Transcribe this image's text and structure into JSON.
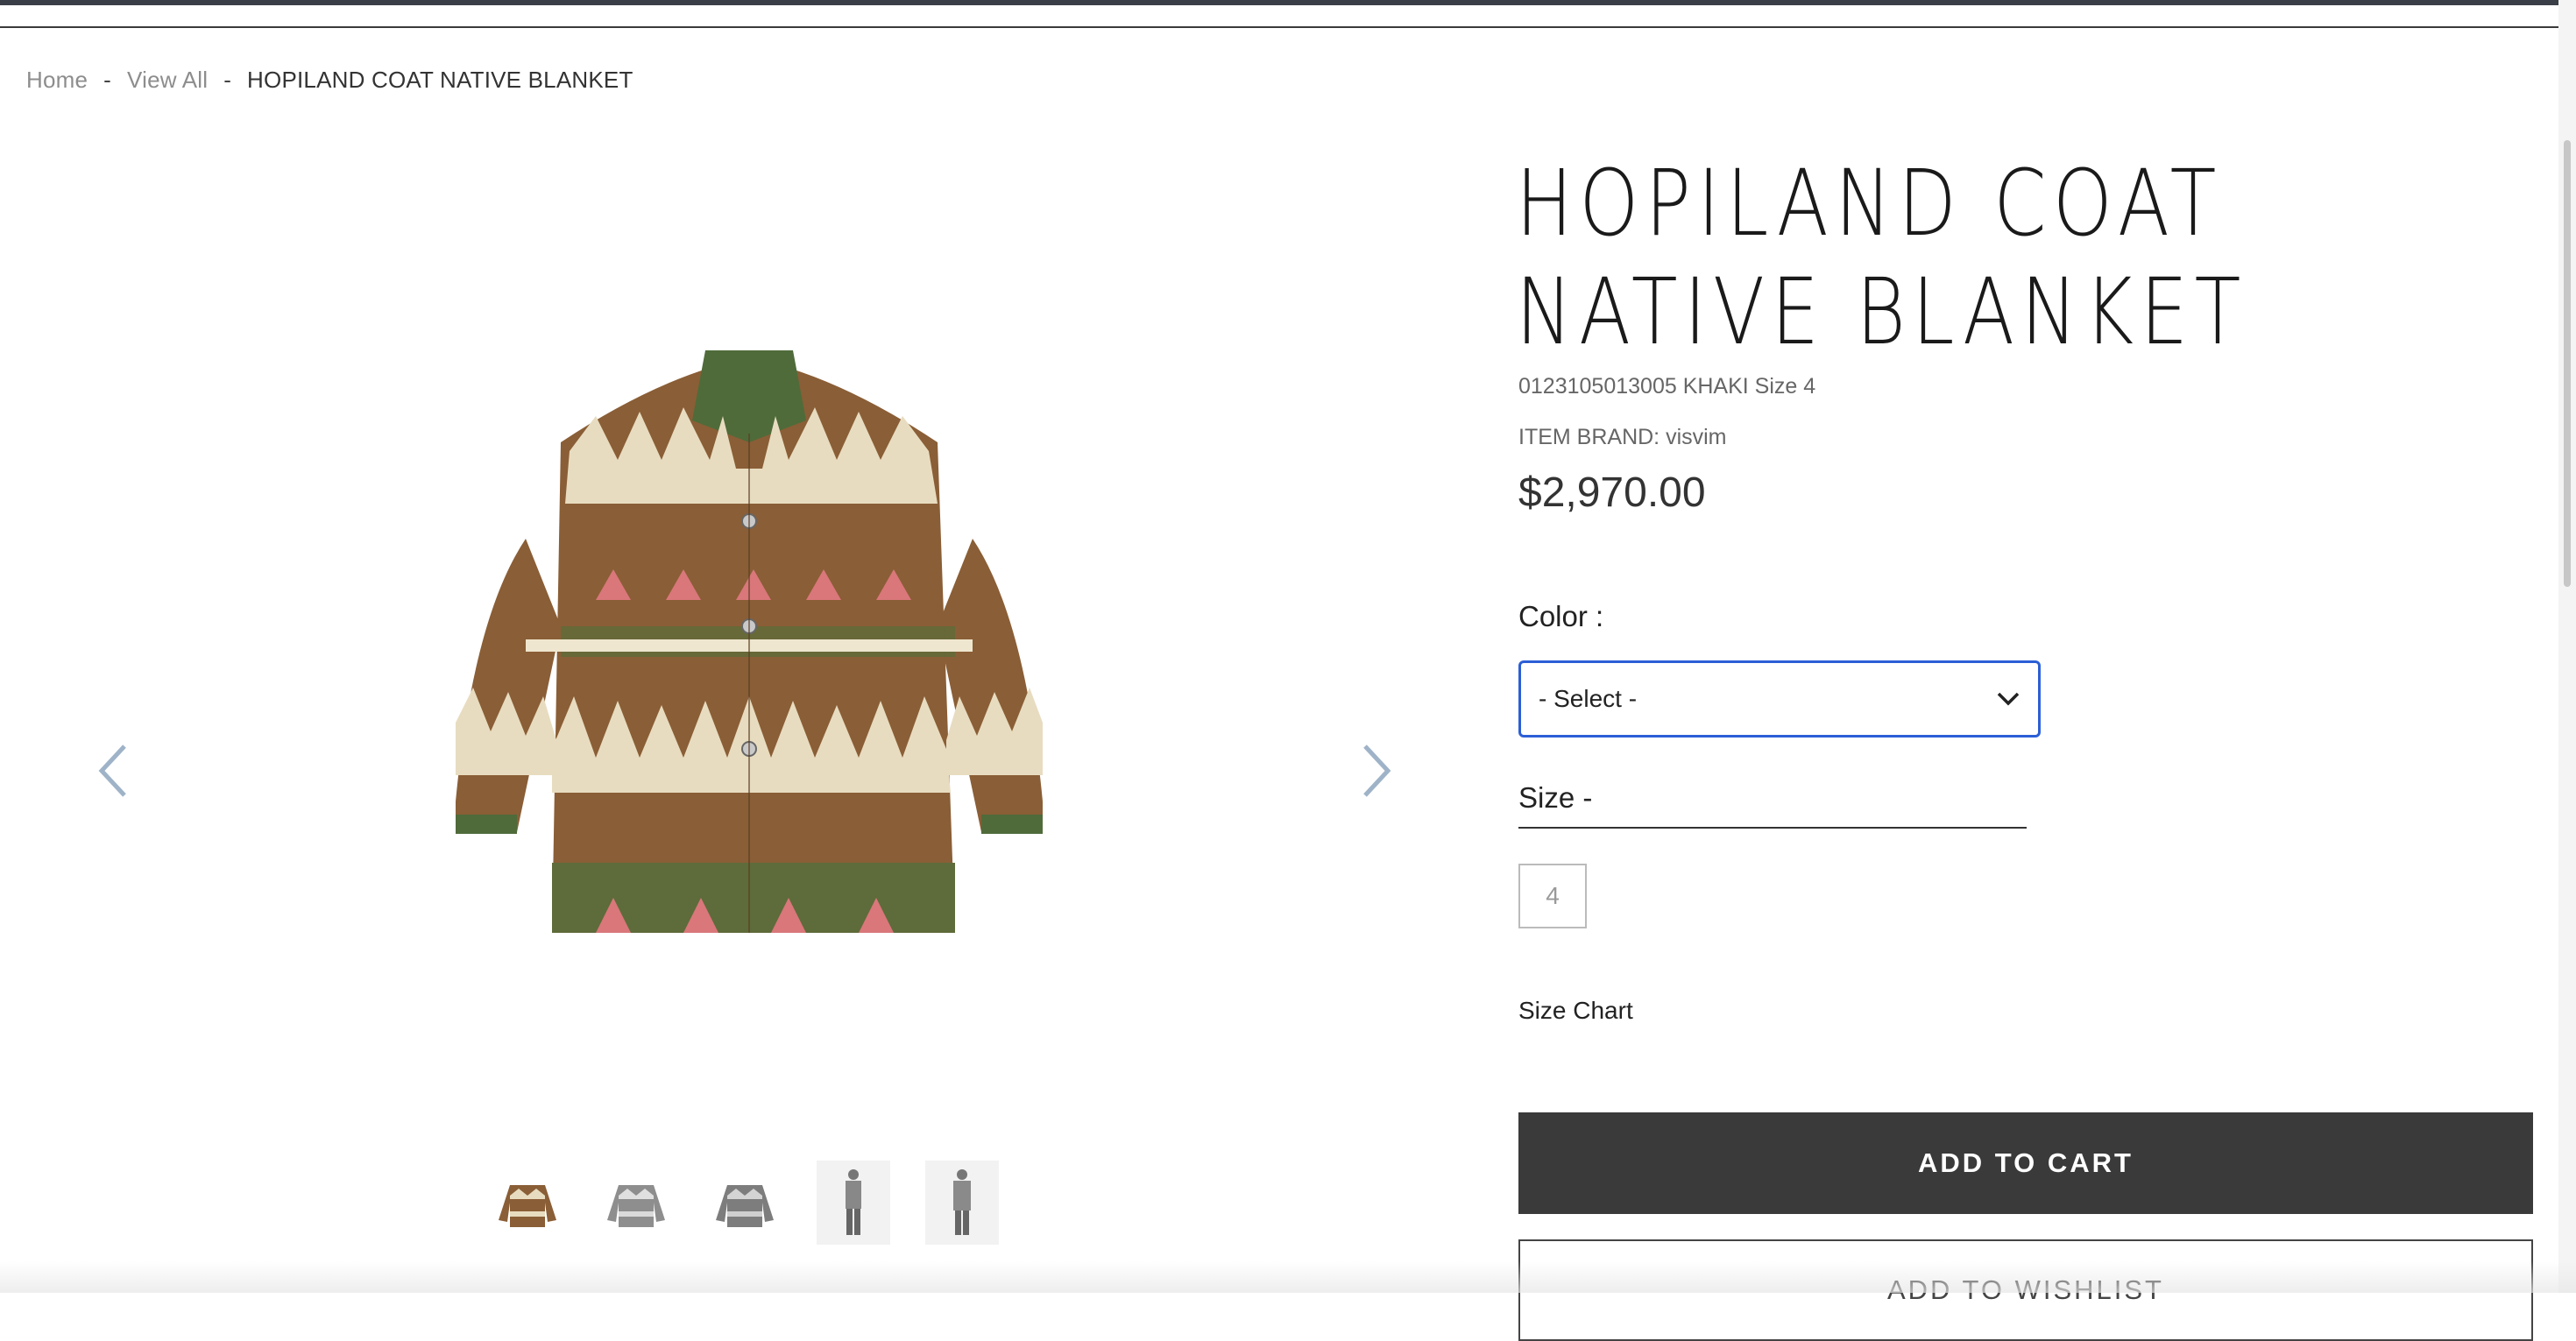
{
  "breadcrumb": {
    "home": "Home",
    "sep1": "-",
    "view_all": "View All",
    "sep2": "-",
    "current": "HOPILAND COAT NATIVE BLANKET"
  },
  "product": {
    "title": "HOPILAND COAT NATIVE BLANKET",
    "sku_line": "0123105013005 KHAKI Size 4",
    "brand_line": "ITEM BRAND: visvim",
    "price": "$2,970.00"
  },
  "options": {
    "color_label": "Color :",
    "color_select_value": "- Select -",
    "size_label": "Size -",
    "sizes": [
      "4"
    ],
    "size_chart": "Size Chart"
  },
  "actions": {
    "add_to_cart": "ADD TO CART",
    "add_to_wishlist": "ADD TO WISHLIST"
  },
  "gallery": {
    "prev_icon": "chevron-left-icon",
    "next_icon": "chevron-right-icon",
    "thumbnail_count": 5
  },
  "colors": {
    "accent_focus": "#2b5fd6",
    "button_dark": "#3a3a3a",
    "arrow": "#9fb3c8"
  }
}
